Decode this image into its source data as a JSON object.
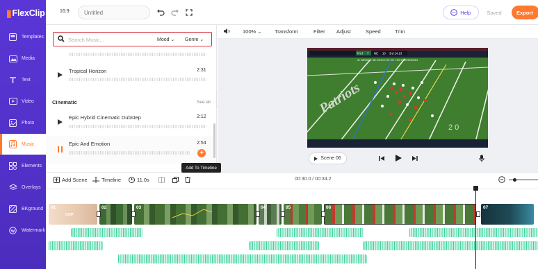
{
  "app": {
    "logo_text": "FlexClip",
    "brand_color": "#5a36d6",
    "accent_color": "#ff7a2e"
  },
  "sidebar": {
    "items": [
      {
        "label": "Templates",
        "icon": "templates-icon"
      },
      {
        "label": "Media",
        "icon": "media-icon"
      },
      {
        "label": "Text",
        "icon": "text-icon"
      },
      {
        "label": "Video",
        "icon": "video-icon"
      },
      {
        "label": "Photo",
        "icon": "photo-icon"
      },
      {
        "label": "Music",
        "icon": "music-icon",
        "active": true
      },
      {
        "label": "Elements",
        "icon": "elements-icon"
      },
      {
        "label": "Overlays",
        "icon": "overlays-icon"
      },
      {
        "label": "BKground",
        "icon": "background-icon"
      },
      {
        "label": "Watermark",
        "icon": "watermark-icon"
      }
    ]
  },
  "topbar": {
    "aspect_ratio": "16:9",
    "title_placeholder": "Untitled",
    "help_label": "Help",
    "saved_label": "Saved",
    "export_label": "Export"
  },
  "music_panel": {
    "search_placeholder": "Search Music...",
    "mood_label": "Mood",
    "genre_label": "Genre",
    "tracks_top": [
      {
        "title": "Tropical Horizon",
        "duration": "2:31"
      }
    ],
    "section_title": "Cinematic",
    "see_all_label": "See all",
    "tracks_cinematic": [
      {
        "title": "Epic Hybrid Cinematic Dubstep",
        "duration": "2:12",
        "state": "paused"
      },
      {
        "title": "Epic And Emotion",
        "duration": "2:54",
        "state": "playing"
      }
    ],
    "tooltip": "Add To Timeline"
  },
  "edit_toolbar": {
    "zoom": "100%",
    "items": [
      "Transform",
      "Filter",
      "Adjust",
      "Speed",
      "Trim"
    ]
  },
  "preview": {
    "scene_label": "Scene 06",
    "scoreboard_team_a": "NYJ",
    "scoreboard_score_a": "7",
    "scoreboard_team_b": "NE",
    "scoreboard_score_b": "10",
    "scoreboard_clock": "3rd 14:13",
    "scoreboard_note": "W. WELKER: 6th CATCH OF 29+ YDS THIS SEASON",
    "field_logo": "Patriots"
  },
  "timeline": {
    "add_scene_label": "Add Scene",
    "timeline_label": "Timeline",
    "duration_label": "11.0s",
    "time_display": "00:30.0 / 00:34.2",
    "scenes": [
      {
        "num": "01"
      },
      {
        "num": "02"
      },
      {
        "num": "03"
      },
      {
        "num": "04"
      },
      {
        "num": "05"
      },
      {
        "num": "06"
      },
      {
        "num": "07"
      }
    ],
    "audio_color": "#3fd4a0"
  }
}
